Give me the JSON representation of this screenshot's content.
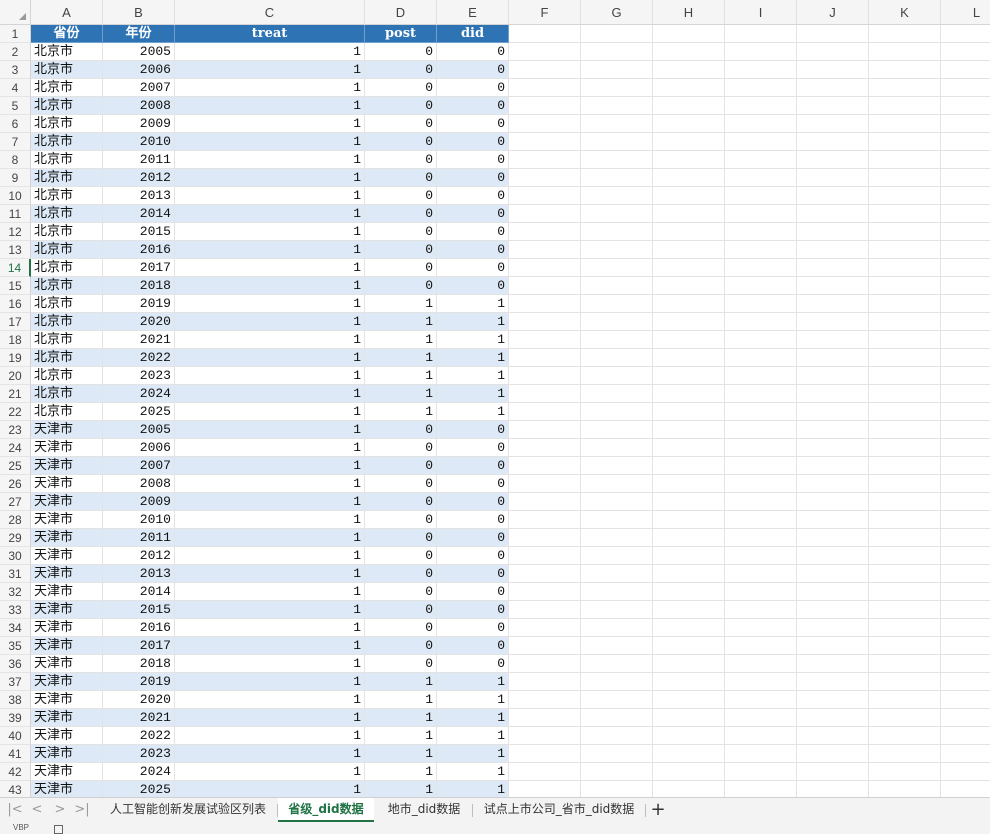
{
  "columns": [
    "A",
    "B",
    "C",
    "D",
    "E",
    "F",
    "G",
    "H",
    "I",
    "J",
    "K",
    "L"
  ],
  "header": [
    "省份",
    "年份",
    "treat",
    "post",
    "did"
  ],
  "rows": [
    [
      "北京市",
      "2005",
      "1",
      "0",
      "0"
    ],
    [
      "北京市",
      "2006",
      "1",
      "0",
      "0"
    ],
    [
      "北京市",
      "2007",
      "1",
      "0",
      "0"
    ],
    [
      "北京市",
      "2008",
      "1",
      "0",
      "0"
    ],
    [
      "北京市",
      "2009",
      "1",
      "0",
      "0"
    ],
    [
      "北京市",
      "2010",
      "1",
      "0",
      "0"
    ],
    [
      "北京市",
      "2011",
      "1",
      "0",
      "0"
    ],
    [
      "北京市",
      "2012",
      "1",
      "0",
      "0"
    ],
    [
      "北京市",
      "2013",
      "1",
      "0",
      "0"
    ],
    [
      "北京市",
      "2014",
      "1",
      "0",
      "0"
    ],
    [
      "北京市",
      "2015",
      "1",
      "0",
      "0"
    ],
    [
      "北京市",
      "2016",
      "1",
      "0",
      "0"
    ],
    [
      "北京市",
      "2017",
      "1",
      "0",
      "0"
    ],
    [
      "北京市",
      "2018",
      "1",
      "0",
      "0"
    ],
    [
      "北京市",
      "2019",
      "1",
      "1",
      "1"
    ],
    [
      "北京市",
      "2020",
      "1",
      "1",
      "1"
    ],
    [
      "北京市",
      "2021",
      "1",
      "1",
      "1"
    ],
    [
      "北京市",
      "2022",
      "1",
      "1",
      "1"
    ],
    [
      "北京市",
      "2023",
      "1",
      "1",
      "1"
    ],
    [
      "北京市",
      "2024",
      "1",
      "1",
      "1"
    ],
    [
      "北京市",
      "2025",
      "1",
      "1",
      "1"
    ],
    [
      "天津市",
      "2005",
      "1",
      "0",
      "0"
    ],
    [
      "天津市",
      "2006",
      "1",
      "0",
      "0"
    ],
    [
      "天津市",
      "2007",
      "1",
      "0",
      "0"
    ],
    [
      "天津市",
      "2008",
      "1",
      "0",
      "0"
    ],
    [
      "天津市",
      "2009",
      "1",
      "0",
      "0"
    ],
    [
      "天津市",
      "2010",
      "1",
      "0",
      "0"
    ],
    [
      "天津市",
      "2011",
      "1",
      "0",
      "0"
    ],
    [
      "天津市",
      "2012",
      "1",
      "0",
      "0"
    ],
    [
      "天津市",
      "2013",
      "1",
      "0",
      "0"
    ],
    [
      "天津市",
      "2014",
      "1",
      "0",
      "0"
    ],
    [
      "天津市",
      "2015",
      "1",
      "0",
      "0"
    ],
    [
      "天津市",
      "2016",
      "1",
      "0",
      "0"
    ],
    [
      "天津市",
      "2017",
      "1",
      "0",
      "0"
    ],
    [
      "天津市",
      "2018",
      "1",
      "0",
      "0"
    ],
    [
      "天津市",
      "2019",
      "1",
      "1",
      "1"
    ],
    [
      "天津市",
      "2020",
      "1",
      "1",
      "1"
    ],
    [
      "天津市",
      "2021",
      "1",
      "1",
      "1"
    ],
    [
      "天津市",
      "2022",
      "1",
      "1",
      "1"
    ],
    [
      "天津市",
      "2023",
      "1",
      "1",
      "1"
    ],
    [
      "天津市",
      "2024",
      "1",
      "1",
      "1"
    ],
    [
      "天津市",
      "2025",
      "1",
      "1",
      "1"
    ]
  ],
  "active_row": 14,
  "tabs": [
    {
      "label": "人工智能创新发展试验区列表",
      "active": false
    },
    {
      "label": "省级_did数据",
      "active": true
    },
    {
      "label": "地市_did数据",
      "active": false
    },
    {
      "label": "试点上市公司_省市_did数据",
      "active": false
    }
  ],
  "add_tab_label": "+",
  "nav_icons": [
    "first-sheet-icon",
    "prev-sheet-icon",
    "next-sheet-icon",
    "last-sheet-icon"
  ],
  "status": {
    "vba_label": "VBP"
  },
  "colors": {
    "header_fill": "#2e74b5",
    "band_fill": "#dde9f6",
    "accent": "#217346"
  }
}
